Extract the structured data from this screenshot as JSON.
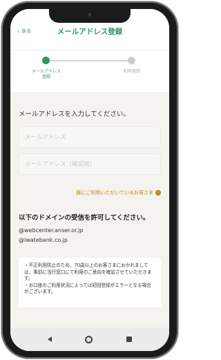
{
  "header": {
    "back_label": "戻る",
    "title": "メールアドレス登録"
  },
  "stepper": {
    "steps": [
      {
        "label_line1": "メールアドレス",
        "label_line2": "登録",
        "state": "active"
      },
      {
        "label_line1": "利用登録",
        "label_line2": "",
        "state": "inactive"
      }
    ]
  },
  "form": {
    "prompt": "メールアドレスを入力してください。",
    "email_placeholder": "メールアドレス",
    "email_confirm_placeholder": "メールアドレス（確認用）"
  },
  "existing_user_link": "既にご利用いただいているお客さま",
  "domains": {
    "title": "以下のドメインの受信を許可してください。",
    "items": [
      "@webcenter.anser.or.jp",
      "@iwatebank.co.jp"
    ]
  },
  "notice": {
    "line1": "・不正利用防止のため、70歳以上のお客さまにおかれましては、事前に当行窓口にて利用のご意向を確認させていただきます。",
    "line2": "・お口座のご利用状況によっては初回登録がエラーとなる場合がございます。"
  },
  "colors": {
    "accent": "#2e9566",
    "link": "#b8860b",
    "background": "#f4f3ef"
  }
}
